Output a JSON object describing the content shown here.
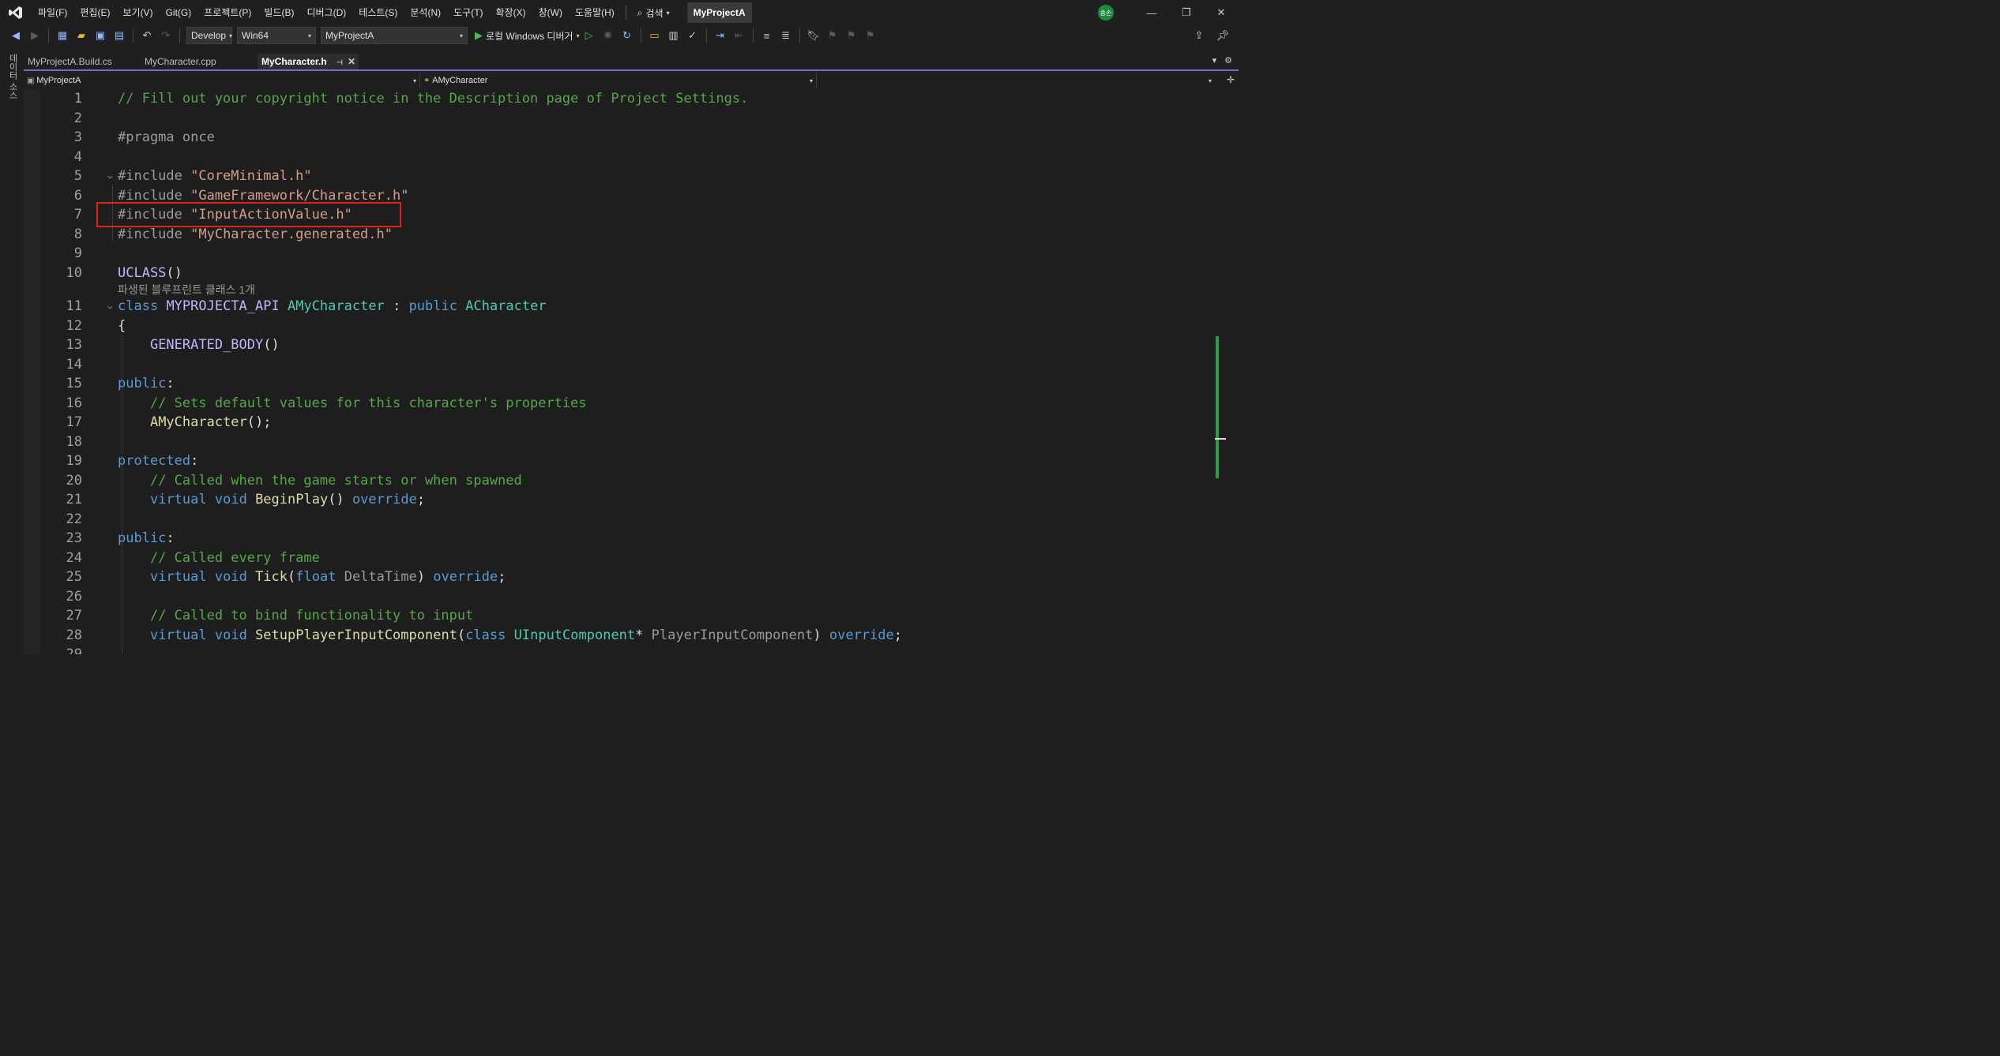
{
  "menubar": {
    "items": [
      "파일(F)",
      "편집(E)",
      "보기(V)",
      "Git(G)",
      "프로젝트(P)",
      "빌드(B)",
      "디버그(D)",
      "테스트(S)",
      "분석(N)",
      "도구(T)",
      "확장(X)",
      "창(W)",
      "도움말(H)"
    ],
    "search_label": "검색",
    "project_name": "MyProjectA",
    "avatar_initials": "송손"
  },
  "toolbar": {
    "config": "Develop",
    "platform": "Win64",
    "startup_project": "MyProjectA",
    "debug_target": "로컬 Windows 디버거"
  },
  "sidebar": {
    "tab_label": "데이터 소스"
  },
  "tabs": [
    {
      "label": "MyProjectA.Build.cs"
    },
    {
      "label": "MyCharacter.cpp"
    },
    {
      "label": "MyCharacter.h"
    }
  ],
  "navbar": {
    "project": "MyProjectA",
    "scope": "AMyCharacter",
    "member": ""
  },
  "editor": {
    "inline_hint": "파생된 블루프린트 클래스 1개",
    "lines": [
      {
        "n": "1",
        "code": "// Fill out your copyright notice in the Description page of Project Settings."
      },
      {
        "n": "2",
        "code": ""
      },
      {
        "n": "3",
        "code": "#pragma once"
      },
      {
        "n": "4",
        "code": ""
      },
      {
        "n": "5",
        "code": "#include \"CoreMinimal.h\""
      },
      {
        "n": "6",
        "code": "#include \"GameFramework/Character.h\""
      },
      {
        "n": "7",
        "code": "#include \"InputActionValue.h\""
      },
      {
        "n": "8",
        "code": "#include \"MyCharacter.generated.h\""
      },
      {
        "n": "9",
        "code": ""
      },
      {
        "n": "10",
        "code": "UCLASS()"
      },
      {
        "n": "11",
        "code": "class MYPROJECTA_API AMyCharacter : public ACharacter"
      },
      {
        "n": "12",
        "code": "{"
      },
      {
        "n": "13",
        "code": "    GENERATED_BODY()"
      },
      {
        "n": "14",
        "code": ""
      },
      {
        "n": "15",
        "code": "public:"
      },
      {
        "n": "16",
        "code": "    // Sets default values for this character's properties"
      },
      {
        "n": "17",
        "code": "    AMyCharacter();"
      },
      {
        "n": "18",
        "code": ""
      },
      {
        "n": "19",
        "code": "protected:"
      },
      {
        "n": "20",
        "code": "    // Called when the game starts or when spawned"
      },
      {
        "n": "21",
        "code": "    virtual void BeginPlay() override;"
      },
      {
        "n": "22",
        "code": ""
      },
      {
        "n": "23",
        "code": "public:"
      },
      {
        "n": "24",
        "code": "    // Called every frame"
      },
      {
        "n": "25",
        "code": "    virtual void Tick(float DeltaTime) override;"
      },
      {
        "n": "26",
        "code": ""
      },
      {
        "n": "27",
        "code": "    // Called to bind functionality to input"
      },
      {
        "n": "28",
        "code": "    virtual void SetupPlayerInputComponent(class UInputComponent* PlayerInputComponent) override;"
      },
      {
        "n": "29",
        "code": ""
      }
    ]
  },
  "colors": {
    "comment": "#57a64a",
    "keyword": "#569cd6",
    "string": "#d69d85",
    "type": "#4ec9b0",
    "function": "#dcdcaa",
    "highlight_box": "#e0201b",
    "active_tab_accent": "#7b68c8"
  }
}
